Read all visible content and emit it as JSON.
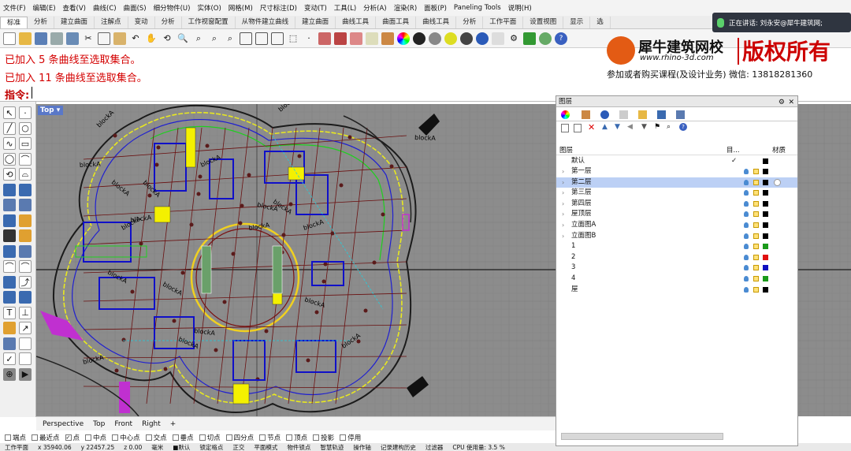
{
  "menu": [
    "文件(F)",
    "编辑(E)",
    "查看(V)",
    "曲线(C)",
    "曲面(S)",
    "细分物件(U)",
    "实体(O)",
    "网格(M)",
    "尺寸标注(D)",
    "变动(T)",
    "工具(L)",
    "分析(A)",
    "渲染(R)",
    "面板(P)",
    "Paneling Tools",
    "说明(H)"
  ],
  "tabs": [
    "标准",
    "分析",
    "建立曲面",
    "注解点",
    "变动",
    "分析",
    "工作视窗配置",
    "从物件建立曲线",
    "建立曲面",
    "曲线工具",
    "曲面工具",
    "曲线工具",
    "分析",
    "工作平面",
    "设置视图",
    "显示",
    "选"
  ],
  "notification": "正在讲话: 刘永安@犀牛建筑网;",
  "command_history": [
    "已加入 5 条曲线至选取集合。",
    "已加入 11 条曲线至选取集合。"
  ],
  "command_prompt": "指令:",
  "watermark": {
    "brand": "犀牛建筑网校",
    "url": "www.rhino-3d.com",
    "copyright": "版权所有",
    "contact": "参加或者购买课程(及设计业务) 微信: 13818281360"
  },
  "viewport": {
    "label": "Top",
    "block_labels": [
      "blockA",
      "blockA",
      "blockA",
      "blockA",
      "blockA",
      "blockA",
      "blockA",
      "blockA",
      "blockA",
      "blockA",
      "blockA",
      "blockA",
      "blockA",
      "blockA",
      "blockA",
      "blockA",
      "blockA",
      "blockA",
      "blockA",
      "blockA"
    ]
  },
  "view_tabs": [
    "Perspective",
    "Top",
    "Front",
    "Right",
    "+"
  ],
  "osnaps": [
    {
      "label": "端点",
      "on": false
    },
    {
      "label": "最近点",
      "on": false
    },
    {
      "label": "点",
      "on": true
    },
    {
      "label": "中点",
      "on": false
    },
    {
      "label": "中心点",
      "on": false
    },
    {
      "label": "交点",
      "on": false
    },
    {
      "label": "垂点",
      "on": false
    },
    {
      "label": "切点",
      "on": false
    },
    {
      "label": "四分点",
      "on": false
    },
    {
      "label": "节点",
      "on": false
    },
    {
      "label": "顶点",
      "on": false
    },
    {
      "label": "投影",
      "on": false
    },
    {
      "label": "停用",
      "on": false
    }
  ],
  "status": [
    "工作平面",
    "x 35940.06",
    "y 22457.25",
    "z 0.00",
    "毫米",
    "■默认",
    "锁定格点",
    "正交",
    "平面模式",
    "物件锁点",
    "智慧轨迹",
    "操作轴",
    "记录建构历史",
    "过滤器",
    "CPU 使用量: 3.5 %"
  ],
  "layers_panel": {
    "title": "图层",
    "col_layer": "图层",
    "col_target": "目...",
    "col_material": "材质",
    "default_layer": "默认",
    "default_check": "✓",
    "rows": [
      {
        "name": "第一层",
        "color": "#000000",
        "selected": false
      },
      {
        "name": "第二层",
        "color": "#000000",
        "selected": true
      },
      {
        "name": "第三层",
        "color": "#000000",
        "selected": false
      },
      {
        "name": "第四层",
        "color": "#000000",
        "selected": false
      },
      {
        "name": "屋顶层",
        "color": "#000000",
        "selected": false
      },
      {
        "name": "立面图A",
        "color": "#000000",
        "selected": false
      },
      {
        "name": "立面图B",
        "color": "#000000",
        "selected": false
      },
      {
        "name": "1",
        "color": "#1a9a1a",
        "selected": false
      },
      {
        "name": "2",
        "color": "#e01010",
        "selected": false
      },
      {
        "name": "3",
        "color": "#1010c0",
        "selected": false
      },
      {
        "name": "4",
        "color": "#1a9a1a",
        "selected": false
      },
      {
        "name": "屋",
        "color": "#000000",
        "selected": false
      }
    ]
  }
}
